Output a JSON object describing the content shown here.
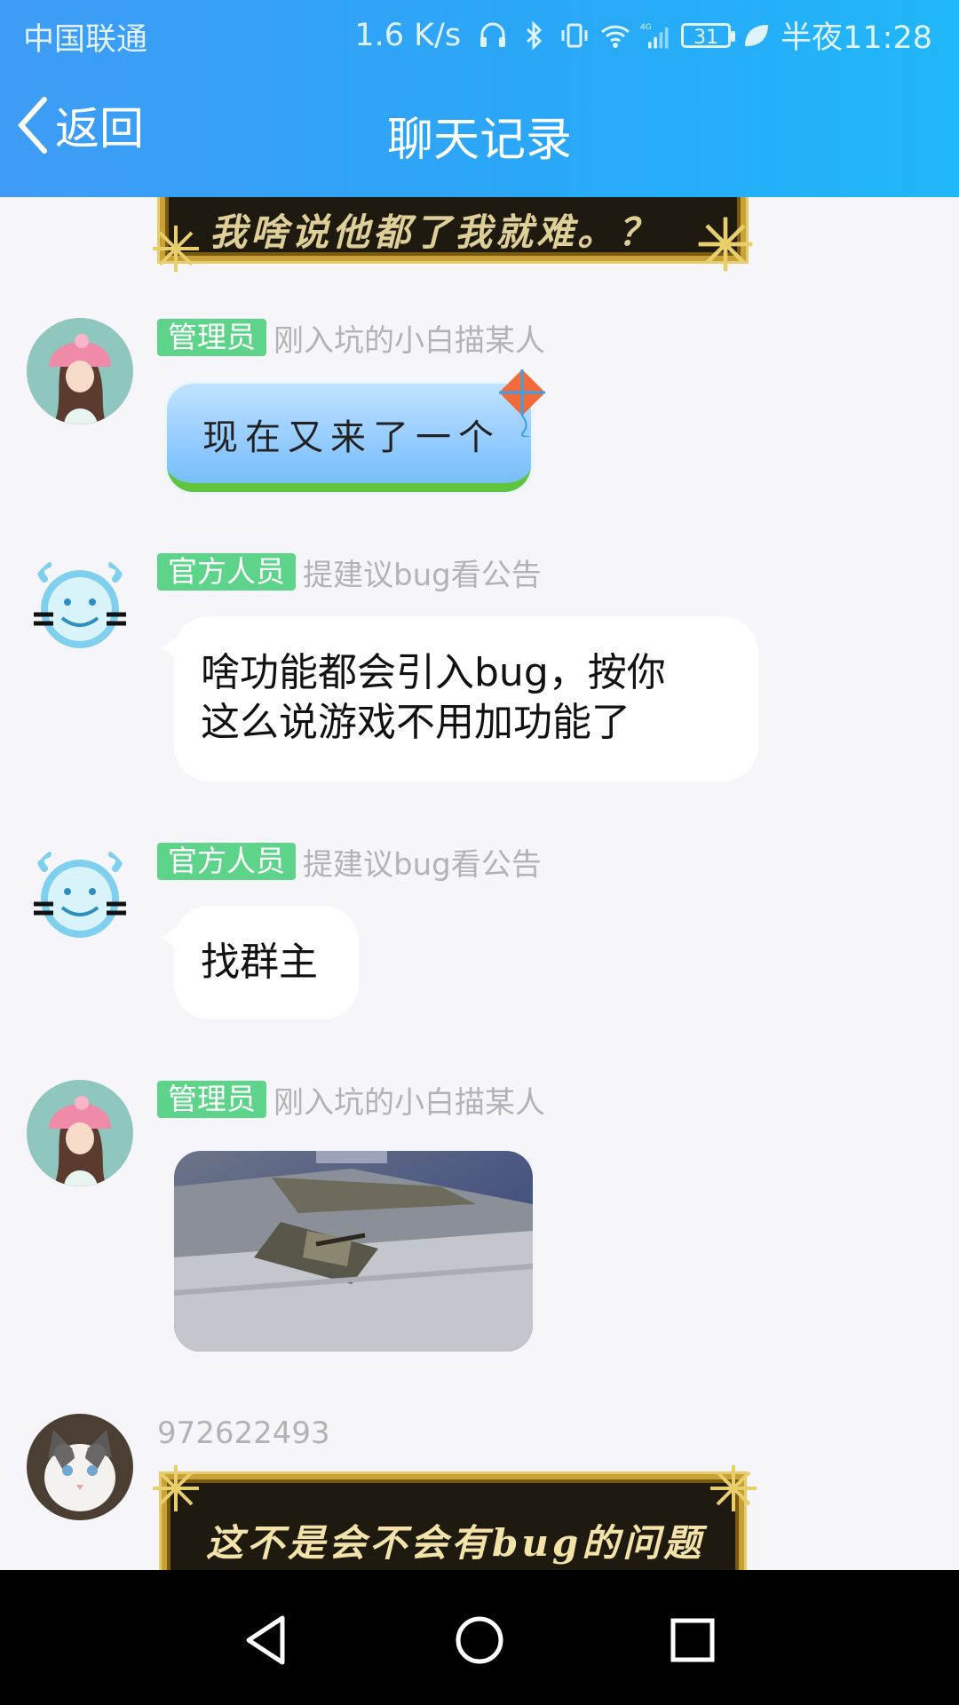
{
  "status_bar": {
    "carrier": "中国联通",
    "speed": "1.6 K/s",
    "network": "4G",
    "battery": "31",
    "time": "半夜11:28"
  },
  "nav": {
    "back_label": "返回",
    "title": "聊天记录"
  },
  "messages": [
    {
      "type": "gold_partial",
      "text": "我啥说他都了我就难。？"
    },
    {
      "role": "管理员",
      "sender": "刚入坑的小白描某人",
      "text": "现在又来了一个"
    },
    {
      "role": "官方人员",
      "sender": "提建议bug看公告",
      "lines": [
        "啥功能都会引入bug，按你",
        "这么说游戏不用加功能了"
      ]
    },
    {
      "role": "官方人员",
      "sender": "提建议bug看公告",
      "text": "找群主"
    },
    {
      "role": "管理员",
      "sender": "刚入坑的小白描某人",
      "image": "game-screenshot"
    },
    {
      "sender": "972622493",
      "text": "这不是会不会有bug的问题"
    }
  ],
  "colors": {
    "header_start": "#3f9cf5",
    "header_end": "#20b7f8",
    "badge": "#5ed38a",
    "background": "#f6f6fa"
  }
}
